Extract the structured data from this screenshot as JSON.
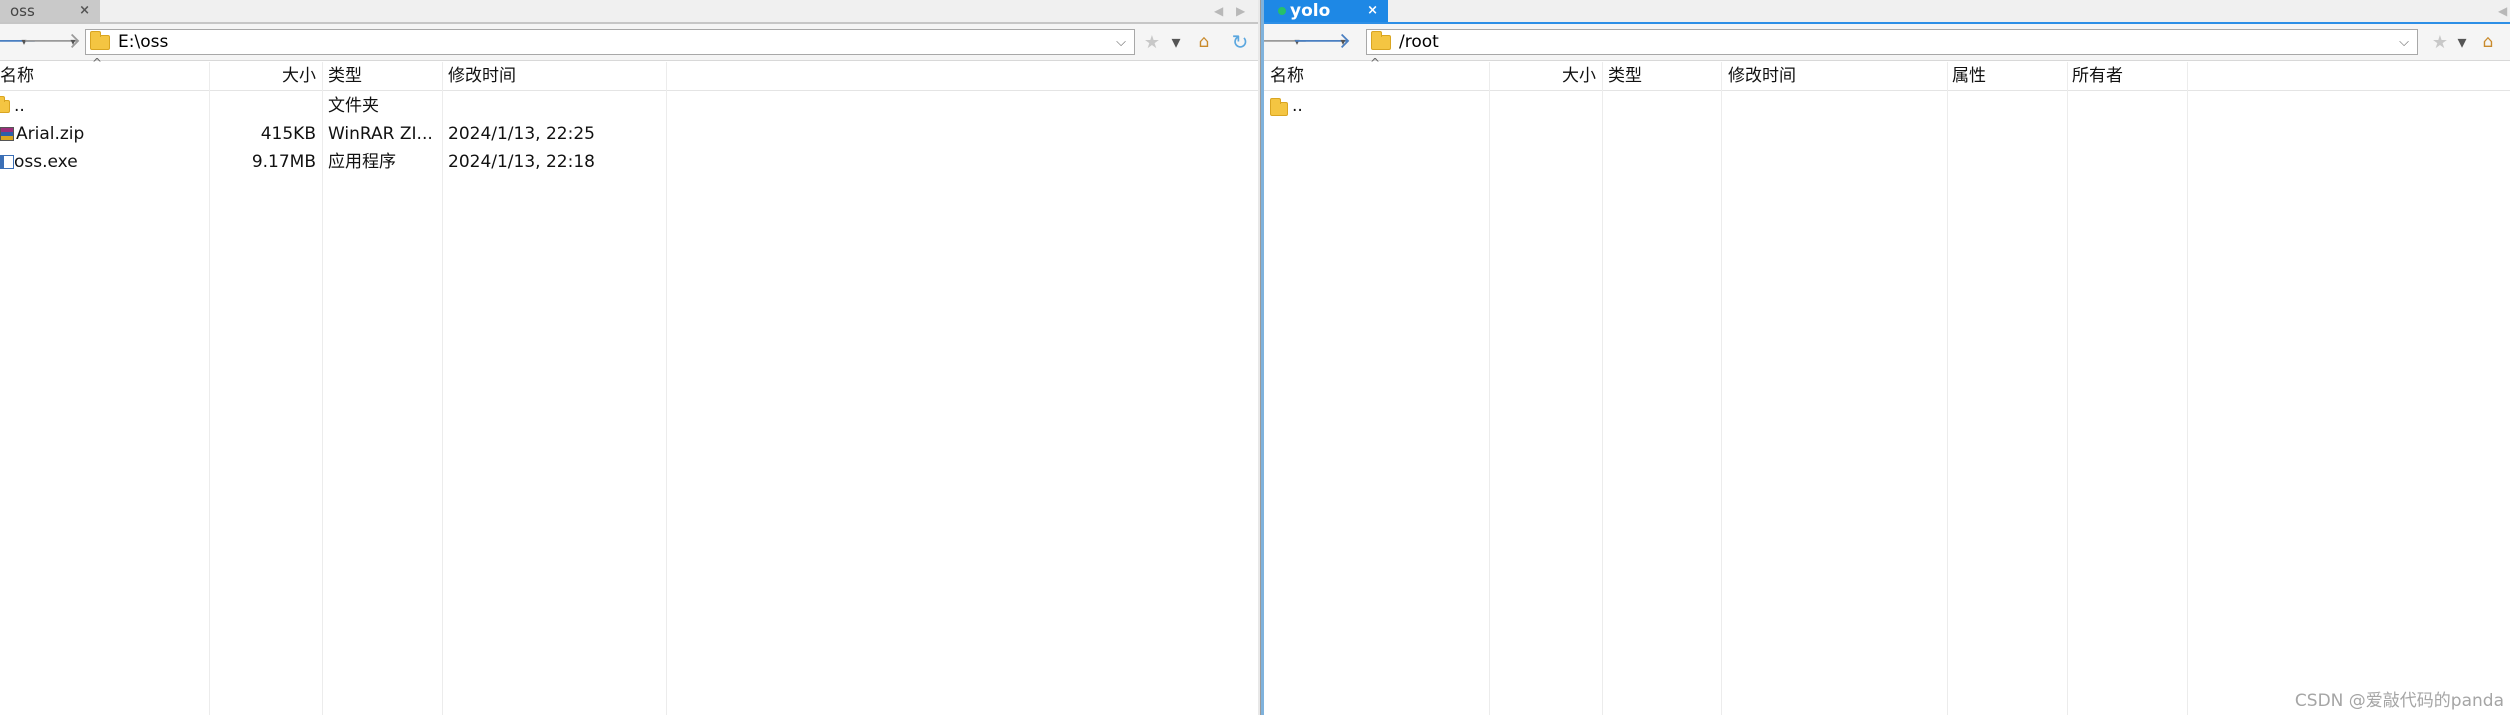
{
  "left_pane": {
    "tab": {
      "label": "oss",
      "close": "×"
    },
    "toolbar": {
      "back": "🡐",
      "forward": "🡒",
      "caret": "▾",
      "address": "E:\\oss",
      "address_caret": "⌵"
    },
    "icons": {
      "favorites": "star-icon",
      "home": "home-icon",
      "refresh": "refresh-icon"
    },
    "columns": {
      "name": "名称",
      "size": "大小",
      "type": "类型",
      "modified": "修改时间"
    },
    "files": [
      {
        "name": "..",
        "size": "",
        "type": "文件夹",
        "modified": "",
        "icon": "folder-icon"
      },
      {
        "name": "Arial.zip",
        "size": "415KB",
        "type": "WinRAR ZI...",
        "modified": "2024/1/13, 22:25",
        "icon": "zip-file-icon"
      },
      {
        "name": "oss.exe",
        "size": "9.17MB",
        "type": "应用程序",
        "modified": "2024/1/13, 22:18",
        "icon": "exe-file-icon"
      }
    ]
  },
  "right_pane": {
    "tab": {
      "label": "yolo",
      "close": "×",
      "status_color": "#26c06a"
    },
    "toolbar": {
      "back": "🡐",
      "forward": "🡒",
      "caret": "▾",
      "address": "/root",
      "address_caret": "⌵"
    },
    "icons": {
      "favorites": "star-icon",
      "home": "home-icon"
    },
    "columns": {
      "name": "名称",
      "size": "大小",
      "type": "类型",
      "modified": "修改时间",
      "attributes": "属性",
      "owner": "所有者"
    },
    "files": [
      {
        "name": "..",
        "icon": "folder-icon"
      }
    ]
  },
  "watermark": "CSDN @爱敲代码的panda",
  "colors": {
    "active_tab": "#1e88e5",
    "inactive_tab": "#c9c9c9",
    "accent_line": "#2d8fe6"
  }
}
